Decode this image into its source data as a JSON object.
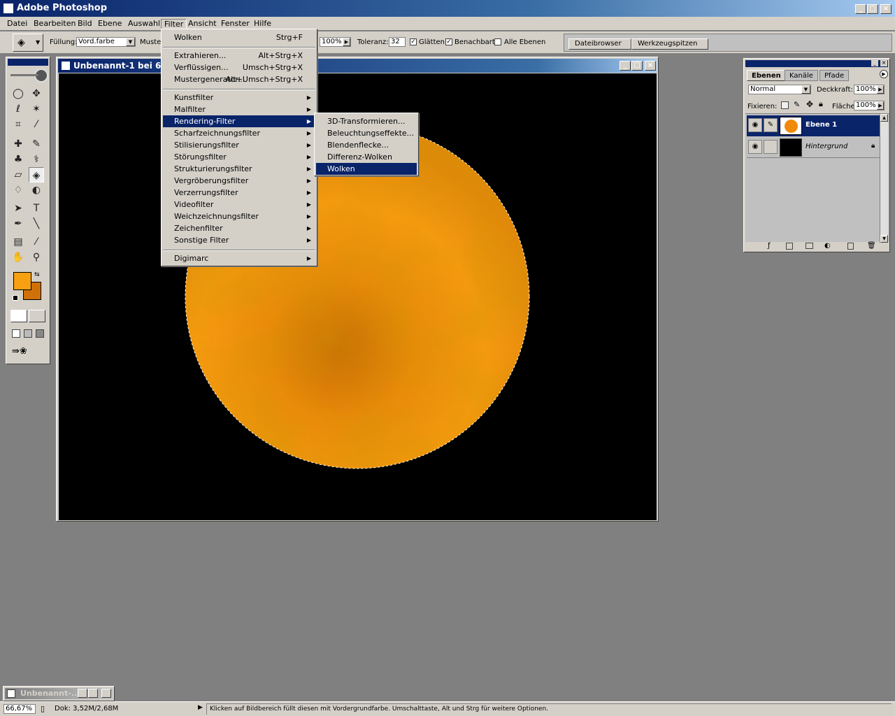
{
  "app": {
    "title": "Adobe Photoshop"
  },
  "menubar": {
    "items": [
      "Datei",
      "Bearbeiten",
      "Bild",
      "Ebene",
      "Auswahl",
      "Filter",
      "Ansicht",
      "Fenster",
      "Hilfe"
    ]
  },
  "options": {
    "fill_label": "Füllung:",
    "fill_value": "Vord.farbe",
    "pattern_label": "Muster",
    "opacity_value": "100%",
    "tolerance_label": "Toleranz:",
    "tolerance_value": "32",
    "smooth_label": "Glätten",
    "contiguous_label": "Benachbart",
    "all_layers_label": "Alle Ebenen",
    "palette_tabs": [
      "Dateibrowser",
      "Werkzeugspitzen"
    ]
  },
  "document": {
    "title": "Unbenannt-1 bei 66,7"
  },
  "filter_menu": {
    "items": [
      {
        "label": "Wolken",
        "shortcut": "Strg+F"
      },
      {
        "label": "Extrahieren...",
        "shortcut": "Alt+Strg+X"
      },
      {
        "label": "Verflüssigen...",
        "shortcut": "Umsch+Strg+X"
      },
      {
        "label": "Mustergenerator...",
        "shortcut": "Alt+Umsch+Strg+X"
      },
      {
        "label": "Kunstfilter"
      },
      {
        "label": "Malfilter"
      },
      {
        "label": "Rendering-Filter"
      },
      {
        "label": "Scharfzeichnungsfilter"
      },
      {
        "label": "Stilisierungsfilter"
      },
      {
        "label": "Störungsfilter"
      },
      {
        "label": "Strukturierungsfilter"
      },
      {
        "label": "Vergröberungsfilter"
      },
      {
        "label": "Verzerrungsfilter"
      },
      {
        "label": "Videofilter"
      },
      {
        "label": "Weichzeichnungsfilter"
      },
      {
        "label": "Zeichenfilter"
      },
      {
        "label": "Sonstige Filter"
      },
      {
        "label": "Digimarc"
      }
    ]
  },
  "render_submenu": {
    "items": [
      "3D-Transformieren...",
      "Beleuchtungseffekte...",
      "Blendenflecke...",
      "Differenz-Wolken",
      "Wolken"
    ]
  },
  "layers_panel": {
    "tabs": [
      "Ebenen",
      "Kanäle",
      "Pfade"
    ],
    "blend_mode": "Normal",
    "opacity_label": "Deckkraft:",
    "opacity_value": "100%",
    "lock_label": "Fixieren:",
    "fill_label": "Fläche",
    "fill_value": "100%",
    "layers": [
      {
        "name": "Ebene 1"
      },
      {
        "name": "Hintergrund"
      }
    ]
  },
  "minimized": {
    "title": "Unbenannt-..."
  },
  "status": {
    "zoom": "66,67%",
    "doc": "Dok: 3,52M/2,68M",
    "message": "Klicken auf Bildbereich füllt diesen mit Vordergrundfarbe. Umschalttaste, Alt und Strg für weitere Optionen."
  },
  "colors": {
    "foreground": "#f7a012",
    "background": "#d07008",
    "accent": "#0a246a"
  }
}
